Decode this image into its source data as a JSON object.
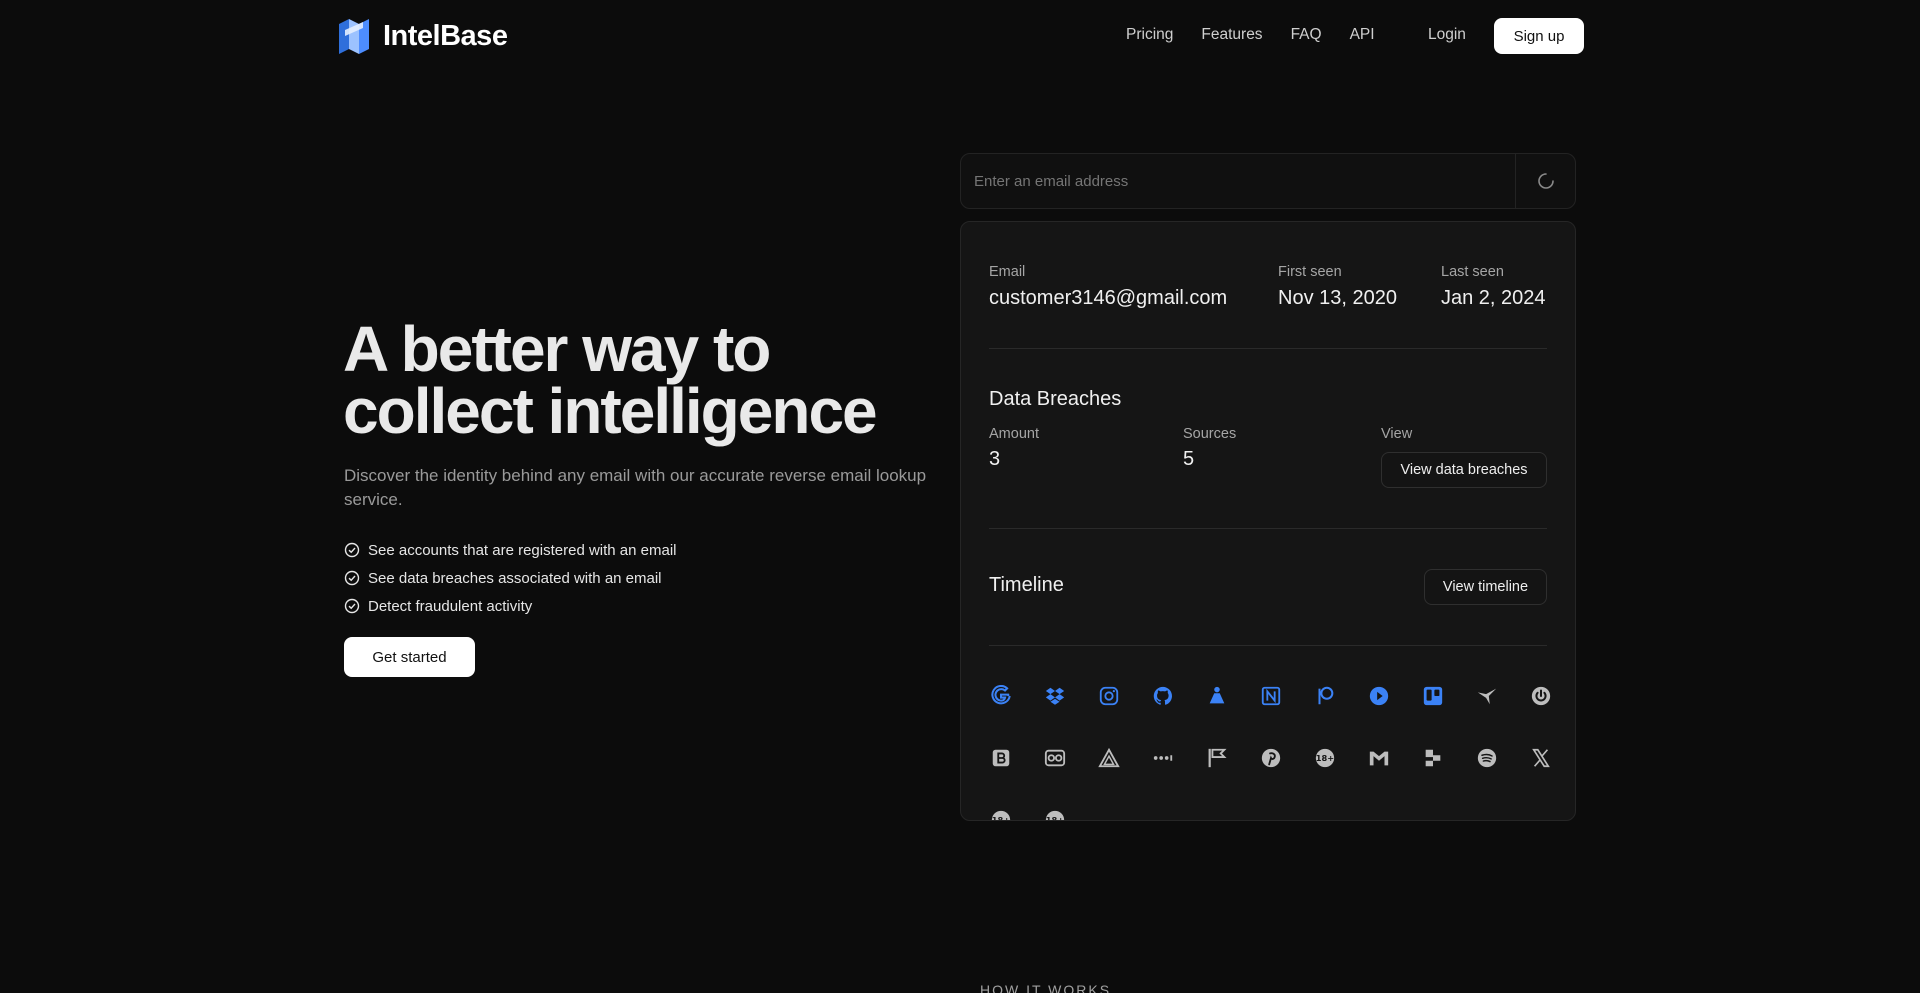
{
  "brand": {
    "name": "IntelBase"
  },
  "nav": {
    "items": [
      "Pricing",
      "Features",
      "FAQ",
      "API"
    ],
    "login": "Login",
    "signup": "Sign up"
  },
  "hero": {
    "title": "A better way to collect intelligence",
    "subtitle": "Discover the identity behind any email with our accurate reverse email lookup service.",
    "features": [
      "See accounts that are registered with an email",
      "See data breaches associated with an email",
      "Detect fraudulent activity"
    ],
    "cta": "Get started"
  },
  "search": {
    "placeholder": "Enter an email address"
  },
  "result": {
    "email_label": "Email",
    "email": "customer3146@gmail.com",
    "first_seen_label": "First seen",
    "first_seen": "Nov 13, 2020",
    "last_seen_label": "Last seen",
    "last_seen": "Jan 2, 2024",
    "breaches": {
      "title": "Data Breaches",
      "amount_label": "Amount",
      "amount": "3",
      "sources_label": "Sources",
      "sources": "5",
      "view_label": "View",
      "view_button": "View data breaches"
    },
    "timeline": {
      "title": "Timeline",
      "button": "View timeline"
    },
    "accounts_row1": [
      "google-icon",
      "dropbox-icon",
      "instagram-icon",
      "github-icon",
      "flask-icon",
      "notion-icon",
      "patreon-icon",
      "play-icon",
      "trello-icon",
      "bird-icon",
      "power-icon"
    ],
    "accounts_row2": [
      "b-square-icon",
      "owl-icon",
      "triangle-icon",
      "dots-icon",
      "flag-icon",
      "pinterest-icon",
      "eighteen-plus-icon",
      "gmail-icon",
      "blocks-icon",
      "spotify-icon",
      "x-icon"
    ],
    "accounts_row3": [
      "eighteen-plus-icon",
      "eighteen-plus-icon"
    ]
  },
  "colors": {
    "accent": "#3b82f6",
    "muted_icon": "#bdbdbd",
    "background": "#0c0c0c",
    "card": "#151515"
  },
  "footer": {
    "section_label": "HOW IT WORKS"
  }
}
